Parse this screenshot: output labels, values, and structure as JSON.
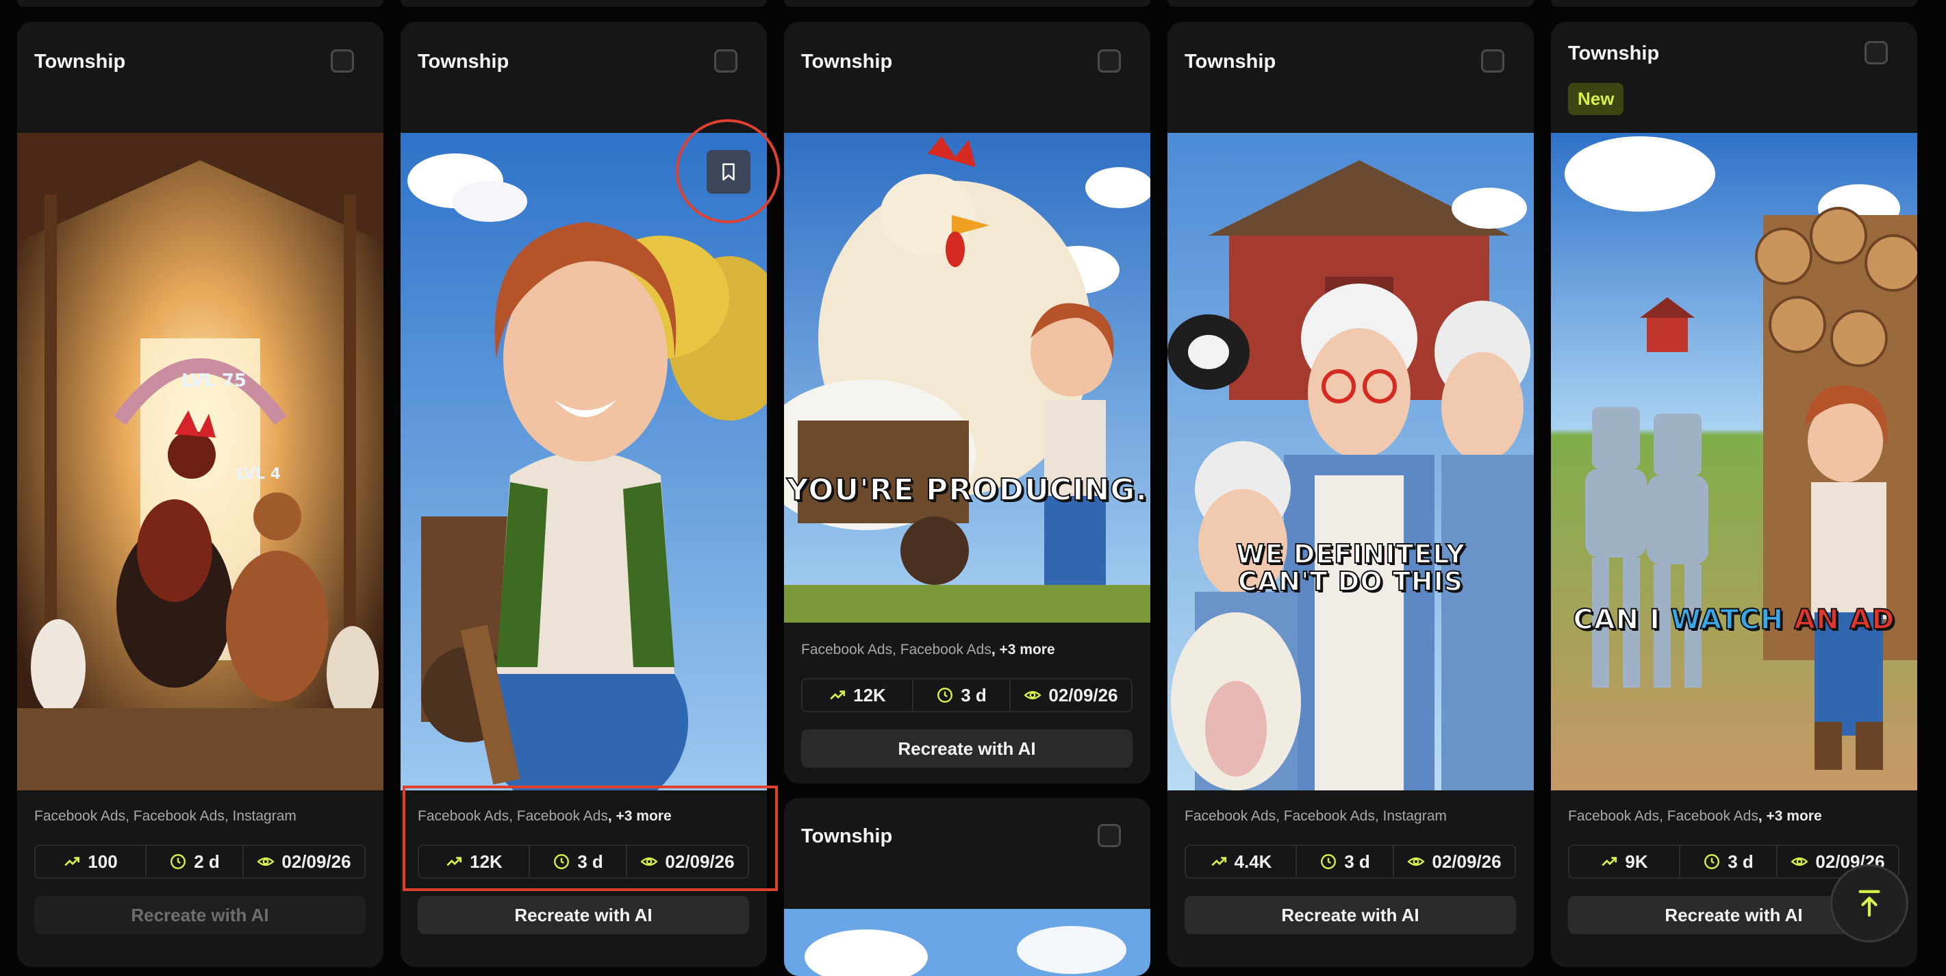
{
  "colors": {
    "accent": "#d8f04a",
    "highlight": "#e0412e",
    "card": "#161616"
  },
  "cards": [
    {
      "title": "Township",
      "sources": "Facebook Ads, Facebook Ads, Instagram",
      "more": "",
      "trend": "100",
      "age": "2 d",
      "date": "02/09/26",
      "cta": "Recreate with AI",
      "caption": "",
      "scene": "barn-chickens"
    },
    {
      "title": "Township",
      "sources": "Facebook Ads, Facebook Ads",
      "more": ", +3 more",
      "trend": "12K",
      "age": "3 d",
      "date": "02/09/26",
      "cta": "Recreate with AI",
      "caption": "",
      "scene": "woman-cart"
    },
    {
      "title": "Township",
      "sources": "Facebook Ads, Facebook Ads",
      "more": ", +3 more",
      "trend": "12K",
      "age": "3 d",
      "date": "02/09/26",
      "cta": "Recreate with AI",
      "caption": "YOU'RE PRODUCING.",
      "scene": "giant-hen"
    },
    {
      "title": "Township",
      "sources": "Facebook Ads, Facebook Ads, Instagram",
      "more": "",
      "trend": "4.4K",
      "age": "3 d",
      "date": "02/09/26",
      "cta": "Recreate with AI",
      "caption": "WE DEFINITELY CAN'T DO THIS",
      "scene": "grannies"
    },
    {
      "title": "Township",
      "badge": "New",
      "sources": "Facebook Ads, Facebook Ads",
      "more": ", +3 more",
      "trend": "9K",
      "age": "3 d",
      "date": "02/09/26",
      "cta": "Recreate with AI",
      "caption_parts": [
        "CAN I ",
        "WATCH",
        " AN AD"
      ],
      "scene": "tin-men"
    },
    {
      "title": "Township",
      "scene": "sky"
    }
  ]
}
